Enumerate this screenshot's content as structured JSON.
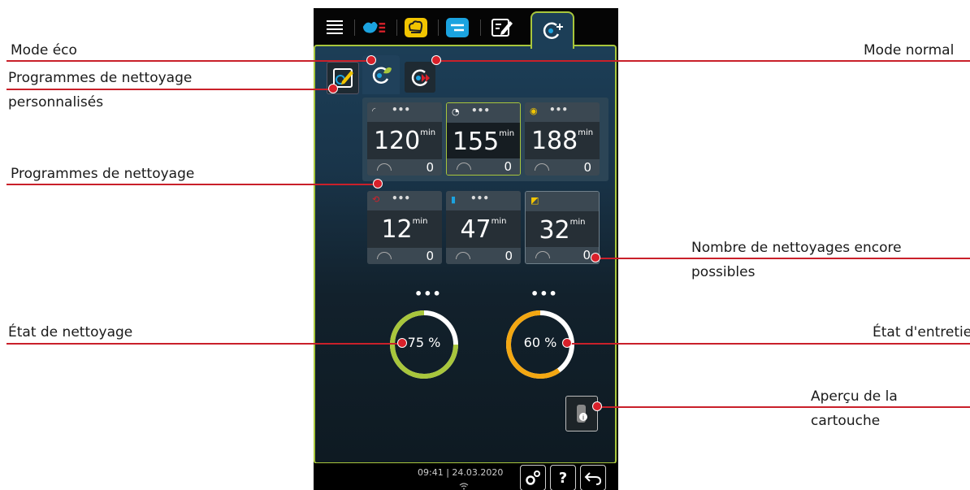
{
  "annotations": {
    "eco_mode": "Mode éco",
    "normal_mode": "Mode normal",
    "custom_programs_line1": "Programmes de nettoyage",
    "custom_programs_line2": "personnalisés",
    "cleaning_programs": "Programmes de nettoyage",
    "remaining_cleanings_line1": "Nombre de nettoyages encore",
    "remaining_cleanings_line2": "possibles",
    "cleaning_state": "État de nettoyage",
    "care_state": "État d'entretien",
    "cartridge_line1": "Aperçu de la",
    "cartridge_line2": "cartouche"
  },
  "programs": [
    {
      "minutes": "120",
      "unit": "min",
      "count": "0",
      "menu": "•••"
    },
    {
      "minutes": "155",
      "unit": "min",
      "count": "0",
      "menu": "•••"
    },
    {
      "minutes": "188",
      "unit": "min",
      "count": "0",
      "menu": "•••"
    },
    {
      "minutes": "12",
      "unit": "min",
      "count": "0",
      "menu": "•••"
    },
    {
      "minutes": "47",
      "unit": "min",
      "count": "0",
      "menu": "•••"
    },
    {
      "minutes": "32",
      "unit": "min",
      "count": "0",
      "menu": "•••"
    }
  ],
  "status": {
    "cleaning": {
      "percent": 75,
      "text": "75 %",
      "color": "#a8c63c",
      "menu": "•••"
    },
    "care": {
      "percent": 60,
      "text": "60 %",
      "color": "#f3a712",
      "menu": "•••"
    }
  },
  "footer": {
    "clock": "09:41 | 24.03.2020",
    "help": "?"
  },
  "colors": {
    "accent_green": "#a8c63c",
    "annotation_red": "#d8202a",
    "tab_blue": "#1ba3e0",
    "tab_yellow": "#f2c500"
  }
}
